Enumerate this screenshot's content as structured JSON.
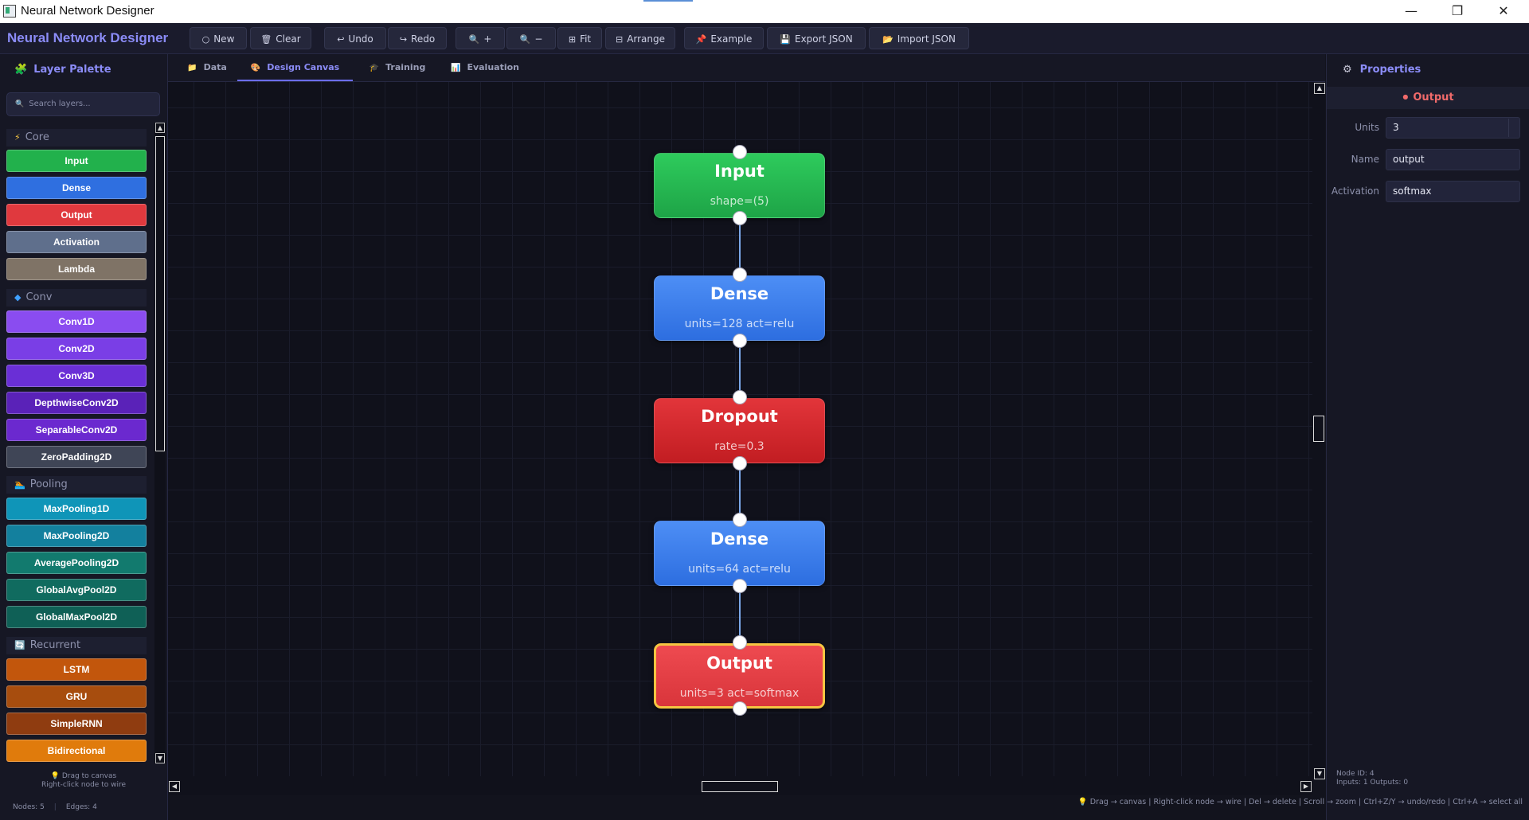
{
  "window": {
    "title": "Neural Network Designer",
    "controls": {
      "minimize": "—",
      "maximize": "❐",
      "close": "✕"
    }
  },
  "toolbar": {
    "app_title": "Neural Network Designer",
    "buttons": [
      {
        "icon": "○",
        "label": "New"
      },
      {
        "icon": "🗑",
        "label": "Clear"
      },
      {
        "icon": "↩",
        "label": "Undo"
      },
      {
        "icon": "↪",
        "label": "Redo"
      },
      {
        "icon": "🔍",
        "label": "+"
      },
      {
        "icon": "🔍",
        "label": "−"
      },
      {
        "icon": "⊞",
        "label": "Fit"
      },
      {
        "icon": "⊟",
        "label": "Arrange"
      },
      {
        "icon": "📌",
        "label": "Example"
      },
      {
        "icon": "💾",
        "label": "Export JSON"
      },
      {
        "icon": "📂",
        "label": "Import JSON"
      }
    ]
  },
  "palette": {
    "header": "Layer Palette",
    "header_icon": "🧩",
    "search_placeholder": "Search layers...",
    "search_icon": "🔍",
    "categories": [
      {
        "name": "Core",
        "icon": "⚡",
        "icon_color": "#f5c542",
        "items": [
          {
            "label": "Input",
            "color": "#22b14c"
          },
          {
            "label": "Dense",
            "color": "#2f6fe0"
          },
          {
            "label": "Output",
            "color": "#e0393e"
          },
          {
            "label": "Activation",
            "color": "#5f6f8c"
          },
          {
            "label": "Lambda",
            "color": "#7f7366"
          }
        ]
      },
      {
        "name": "Conv",
        "icon": "◆",
        "icon_color": "#3fa0ff",
        "items": [
          {
            "label": "Conv1D",
            "color": "#8a4cf0"
          },
          {
            "label": "Conv2D",
            "color": "#7a3ee6"
          },
          {
            "label": "Conv3D",
            "color": "#6a2fd6"
          },
          {
            "label": "DepthwiseConv2D",
            "color": "#5a22b8"
          },
          {
            "label": "SeparableConv2D",
            "color": "#6b29cf"
          },
          {
            "label": "ZeroPadding2D",
            "color": "#3f4556"
          }
        ]
      },
      {
        "name": "Pooling",
        "icon": "🏊",
        "icon_color": "#39b0e0",
        "items": [
          {
            "label": "MaxPooling1D",
            "color": "#0f95b8"
          },
          {
            "label": "MaxPooling2D",
            "color": "#13809e"
          },
          {
            "label": "AveragePooling2D",
            "color": "#127a6e"
          },
          {
            "label": "GlobalAvgPool2D",
            "color": "#106b5f"
          },
          {
            "label": "GlobalMaxPool2D",
            "color": "#0f6056"
          }
        ]
      },
      {
        "name": "Recurrent",
        "icon": "🔄",
        "icon_color": "#3fa0ff",
        "items": [
          {
            "label": "LSTM",
            "color": "#c2560c"
          },
          {
            "label": "GRU",
            "color": "#a74d0e"
          },
          {
            "label": "SimpleRNN",
            "color": "#8f3c10"
          },
          {
            "label": "Bidirectional",
            "color": "#e07b0c"
          }
        ]
      }
    ],
    "hint_line1": "Drag to canvas",
    "hint_line2": "Right-click node to wire",
    "hint_icon": "💡",
    "stats": {
      "nodes": "Nodes: 5",
      "edges": "Edges: 4"
    }
  },
  "tabs": [
    {
      "icon": "📁",
      "label": "Data",
      "active": false
    },
    {
      "icon": "🎨",
      "label": "Design Canvas",
      "active": true
    },
    {
      "icon": "🎓",
      "label": "Training",
      "active": false
    },
    {
      "icon": "📊",
      "label": "Evaluation",
      "active": false
    }
  ],
  "canvas": {
    "nodes": [
      {
        "title": "Input",
        "sub": "shape=(5)",
        "color_top": "#2ecb5c",
        "color_bottom": "#1ea447",
        "selected": false
      },
      {
        "title": "Dense",
        "sub": "units=128  act=relu",
        "color_top": "#4d8ef5",
        "color_bottom": "#2d6ee0",
        "selected": false
      },
      {
        "title": "Dropout",
        "sub": "rate=0.3",
        "color_top": "#e2353a",
        "color_bottom": "#c21d22",
        "selected": false
      },
      {
        "title": "Dense",
        "sub": "units=64  act=relu",
        "color_top": "#4d8ef5",
        "color_bottom": "#2d6ee0",
        "selected": false
      },
      {
        "title": "Output",
        "sub": "units=3  act=softmax",
        "color_top": "#ee4a50",
        "color_bottom": "#d9353b",
        "selected": true,
        "selected_border": "#f5c542"
      }
    ]
  },
  "properties": {
    "header": "Properties",
    "header_icon": "⚙",
    "selected_layer": "Output",
    "selected_icon": "●",
    "fields": [
      {
        "label": "Units",
        "value": "3",
        "spin": true
      },
      {
        "label": "Name",
        "value": "output",
        "spin": false
      },
      {
        "label": "Activation",
        "value": "softmax",
        "spin": false
      }
    ],
    "footer_line1": "Node ID: 4",
    "footer_line2": "Inputs: 1    Outputs: 0"
  },
  "statusbar": {
    "icon": "💡",
    "text": "Drag → canvas  |  Right-click node → wire  |  Del → delete  |  Scroll → zoom  |  Ctrl+Z/Y → undo/redo  |  Ctrl+A → select all"
  }
}
